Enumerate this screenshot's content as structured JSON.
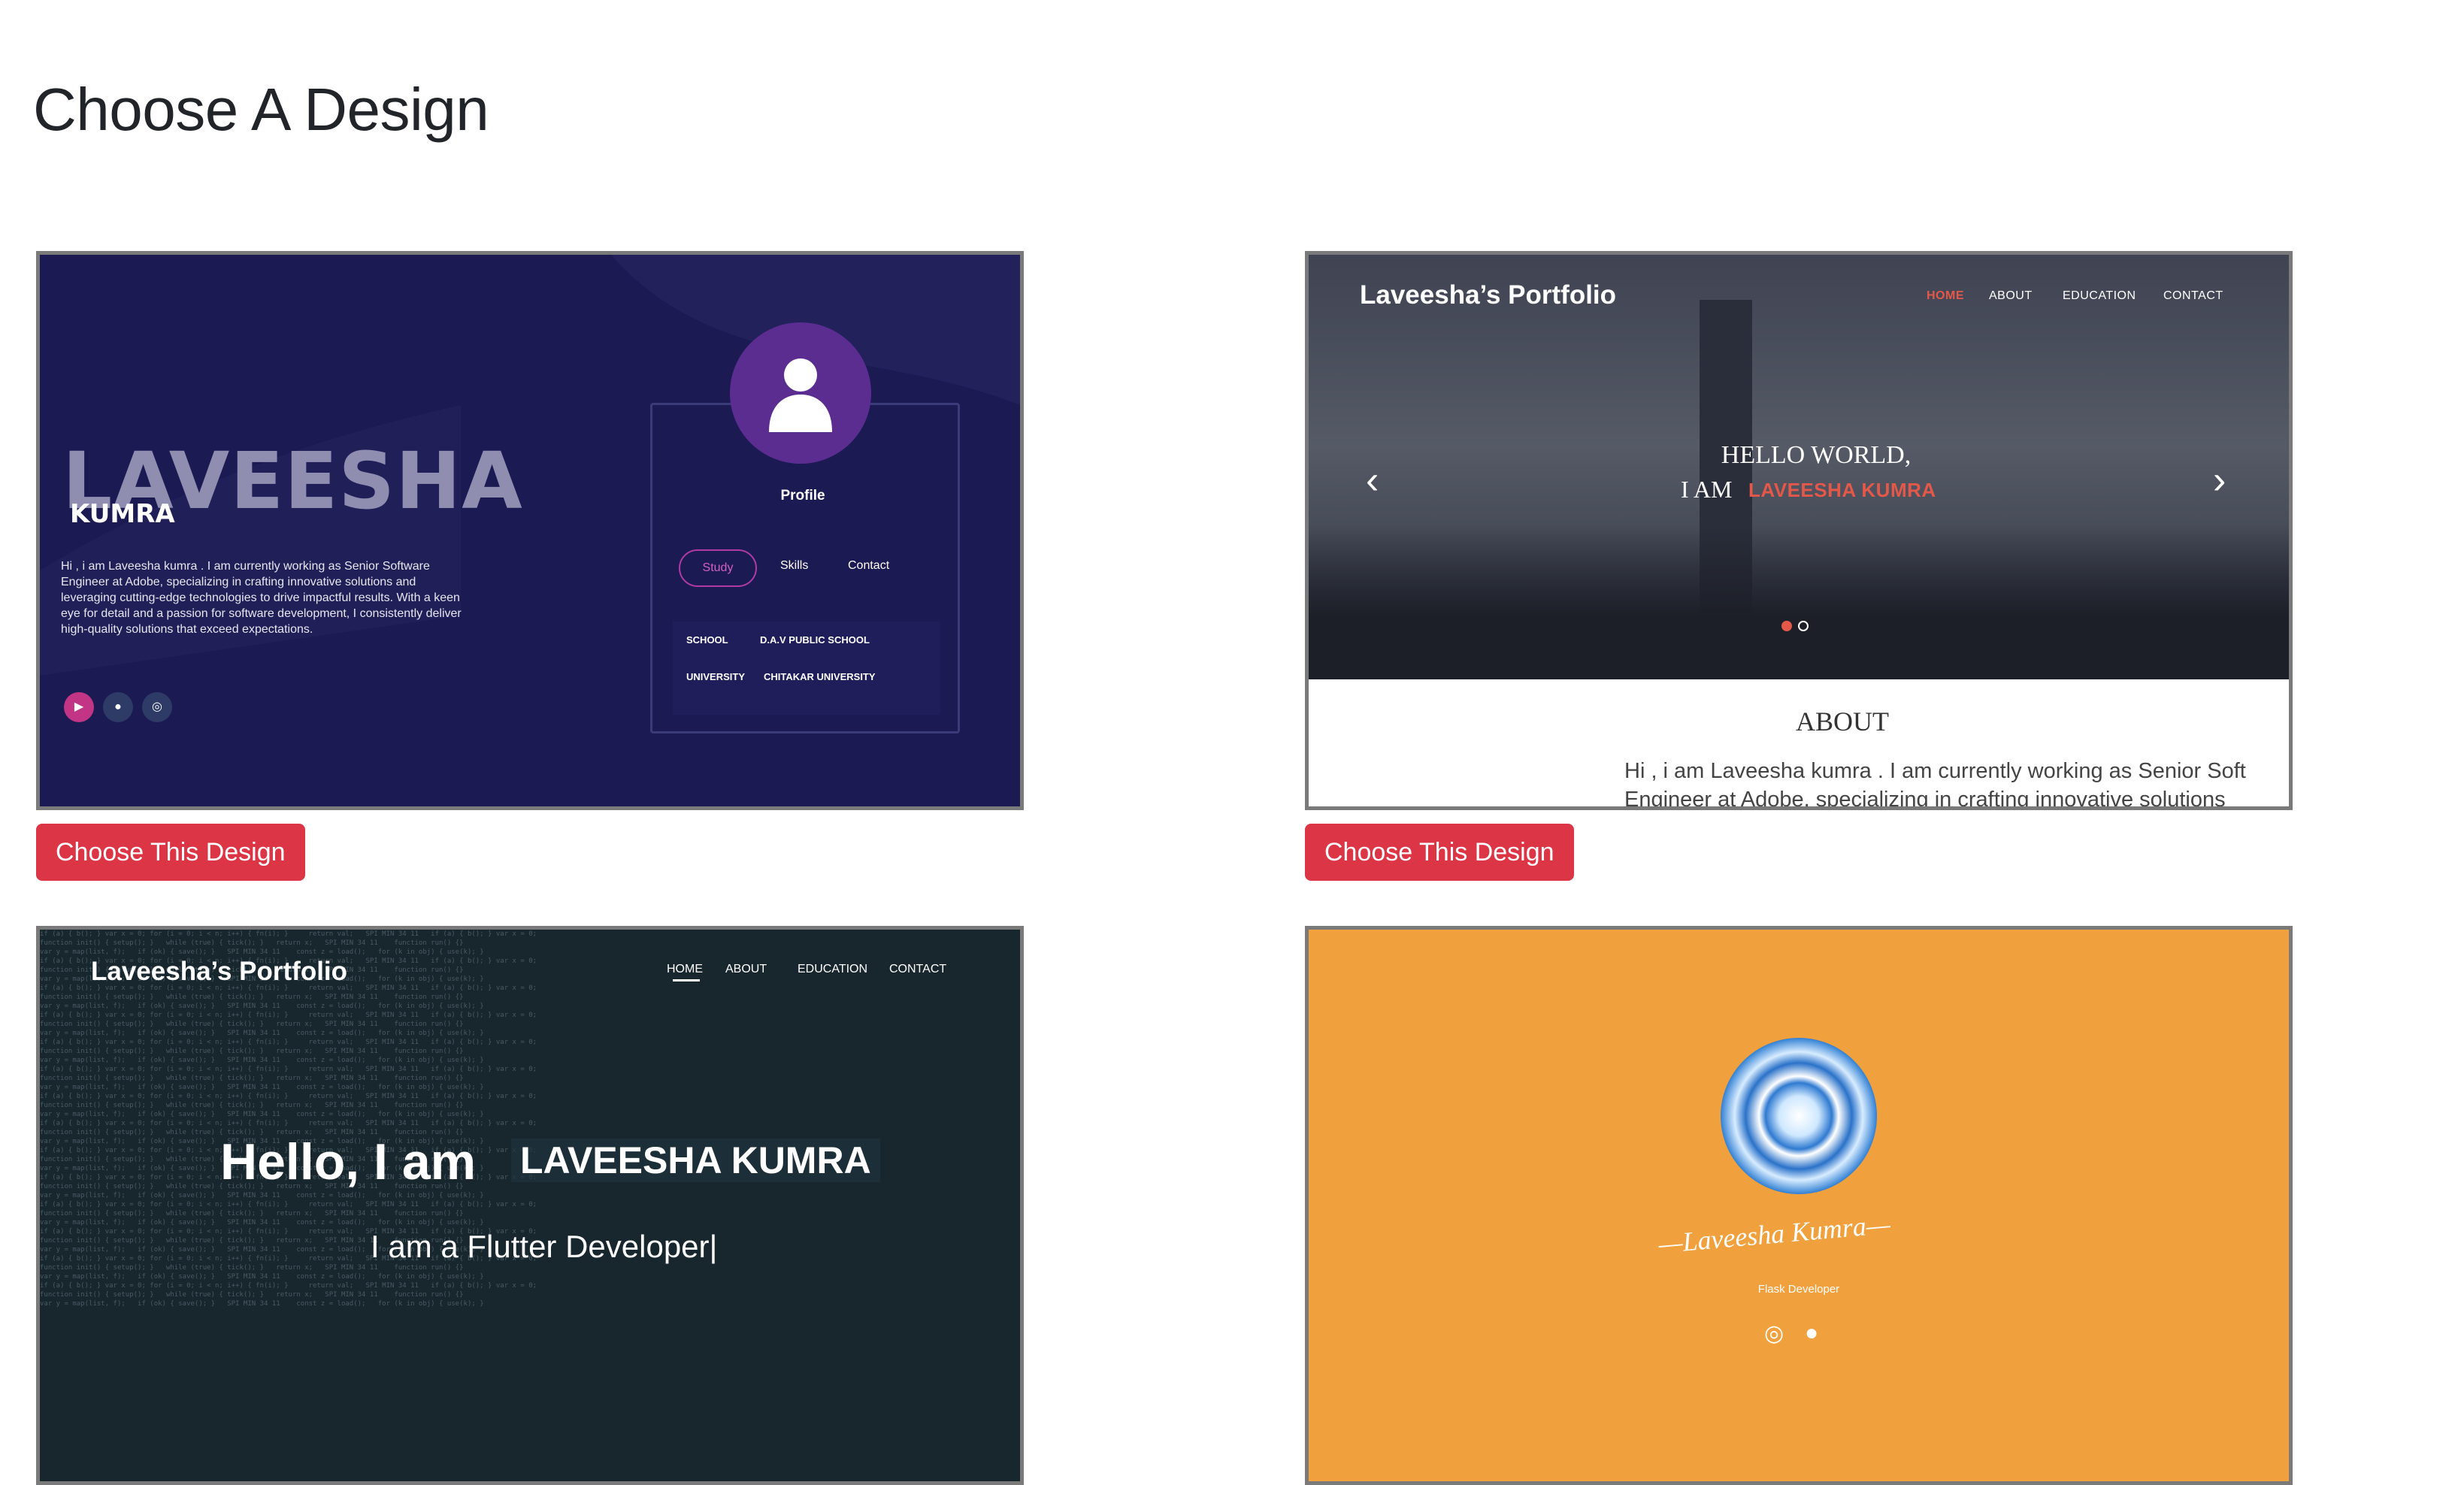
{
  "page": {
    "title": "Choose A Design"
  },
  "choose_button_label": "Choose This Design",
  "design1": {
    "big_name": "LAVEESHA",
    "sub_name": "KUMRA",
    "bio": "Hi , i am Laveesha kumra . I am currently working as Senior Software Engineer at Adobe, specializing in crafting innovative solutions and leveraging cutting-edge technologies to drive impactful results. With a keen eye for detail and a passion for software development, I consistently deliver high-quality solutions that exceed expectations.",
    "profile_label": "Profile",
    "tabs": [
      "Study",
      "Skills",
      "Contact"
    ],
    "table": [
      {
        "k": "SCHOOL",
        "v": "D.A.V PUBLIC SCHOOL"
      },
      {
        "k": "UNIVERSITY",
        "v": "CHITAKAR UNIVERSITY"
      }
    ],
    "social_icons": [
      "youtube-icon",
      "github-icon",
      "instagram-icon"
    ],
    "colors": {
      "background": "#1b1a52",
      "avatar": "#5b2d91",
      "accent": "#b23aa5"
    }
  },
  "design2": {
    "brand": "Laveesha’s Portfolio",
    "nav": [
      "HOME",
      "ABOUT",
      "EDUCATION",
      "CONTACT"
    ],
    "hello": "HELLO WORLD,",
    "iam": "I AM",
    "name": "LAVEESHA KUMRA",
    "about_title": "ABOUT",
    "about_text": "Hi , i am Laveesha kumra . I am currently working as Senior Soft",
    "about_text2": "Engineer at Adobe, specializing in crafting innovative solutions",
    "colors": {
      "accent": "#e4584a"
    }
  },
  "design3": {
    "brand": "Laveesha’s Portfolio",
    "nav": [
      "HOME",
      "ABOUT",
      "EDUCATION",
      "CONTACT"
    ],
    "hello": "Hello, I am",
    "name": "LAVEESHA KUMRA",
    "role_prefix": "I am a",
    "role": "Flutter Developer"
  },
  "design4": {
    "name": "Laveesha Kumra",
    "role": "Flask Developer",
    "social_icons": [
      "instagram-icon",
      "github-icon"
    ],
    "colors": {
      "background": "#f0a03c"
    }
  }
}
